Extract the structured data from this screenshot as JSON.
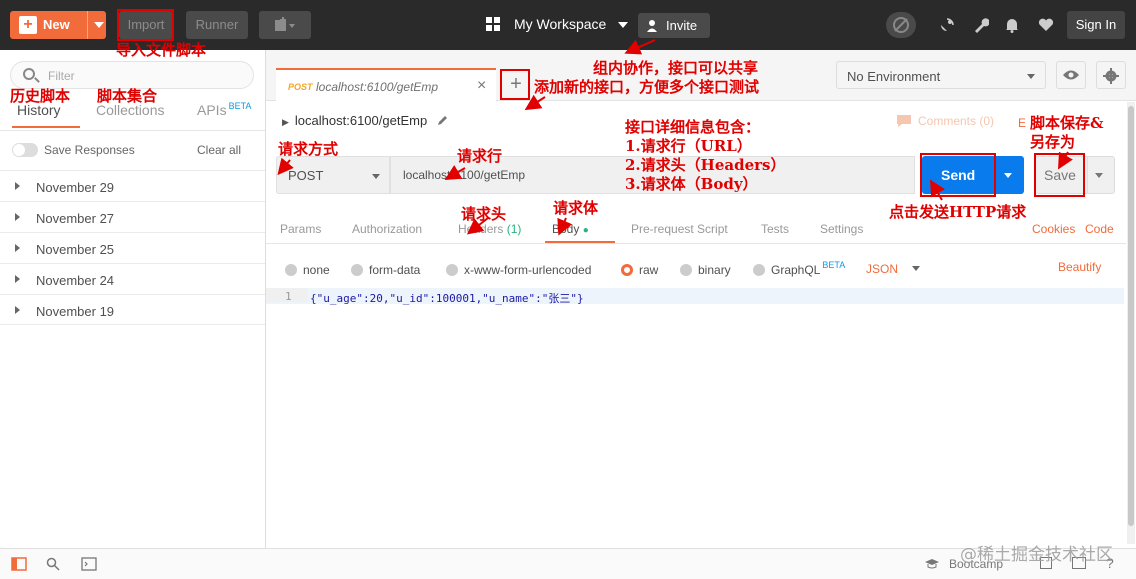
{
  "topbar": {
    "new_label": "New",
    "import_label": "Import",
    "runner_label": "Runner",
    "workspace_label": "My Workspace",
    "invite_label": "Invite",
    "signin_label": "Sign In"
  },
  "sidebar": {
    "filter_placeholder": "Filter",
    "tabs": [
      {
        "label": "History"
      },
      {
        "label": "Collections"
      },
      {
        "label": "APIs",
        "badge": "BETA"
      }
    ],
    "save_responses": "Save Responses",
    "clear_all": "Clear all",
    "history": [
      "November 29",
      "November 27",
      "November 25",
      "November 24",
      "November 19"
    ]
  },
  "request_tab": {
    "method": "POST",
    "url": "localhost:6100/getEmp"
  },
  "environment": {
    "selected": "No Environment"
  },
  "request": {
    "name": "localhost:6100/getEmp",
    "comments": "Comments (0)",
    "examples": "E",
    "method": "POST",
    "url": "localhost:6100/getEmp",
    "send_label": "Send",
    "save_label": "Save"
  },
  "subtabs": {
    "params": "Params",
    "authorization": "Authorization",
    "headers": "Headers",
    "headers_count": "(1)",
    "body": "Body",
    "prerequest": "Pre-request Script",
    "tests": "Tests",
    "settings": "Settings",
    "cookies": "Cookies",
    "code": "Code"
  },
  "body_options": {
    "none": "none",
    "form_data": "form-data",
    "urlencoded": "x-www-form-urlencoded",
    "raw": "raw",
    "binary": "binary",
    "graphql": "GraphQL",
    "graphql_badge": "BETA",
    "format": "JSON",
    "beautify": "Beautify"
  },
  "editor": {
    "line_number": "1",
    "content": "{\"u_age\":20,\"u_id\":100001,\"u_name\":\"张三\"}"
  },
  "statusbar": {
    "bootcamp": "Bootcamp",
    "watermark": "@稀土掘金技术社区"
  },
  "annotations": {
    "import_note": "导入文件脚本",
    "history_note": "历史脚本",
    "collections_note": "脚本集合",
    "team_note": "组内协作，接口可以共享",
    "add_tab_note": "添加新的接口，方便多个接口测试",
    "method_note": "请求方式",
    "request_line_note": "请求行",
    "details_title": "接口详细信息包含：",
    "details_1": "1.请求行（URL）",
    "details_2": "2.请求头（Headers）",
    "details_3": "3.请求体（Body）",
    "save_note_1": "脚本保存&",
    "save_note_2": "另存为",
    "headers_note": "请求头",
    "body_note": "请求体",
    "send_note": "点击发送HTTP请求"
  },
  "colors": {
    "accent": "#f26b3a",
    "send_blue": "#097bed",
    "annotation_red": "#e00000",
    "topbar": "#2a2a2a"
  }
}
